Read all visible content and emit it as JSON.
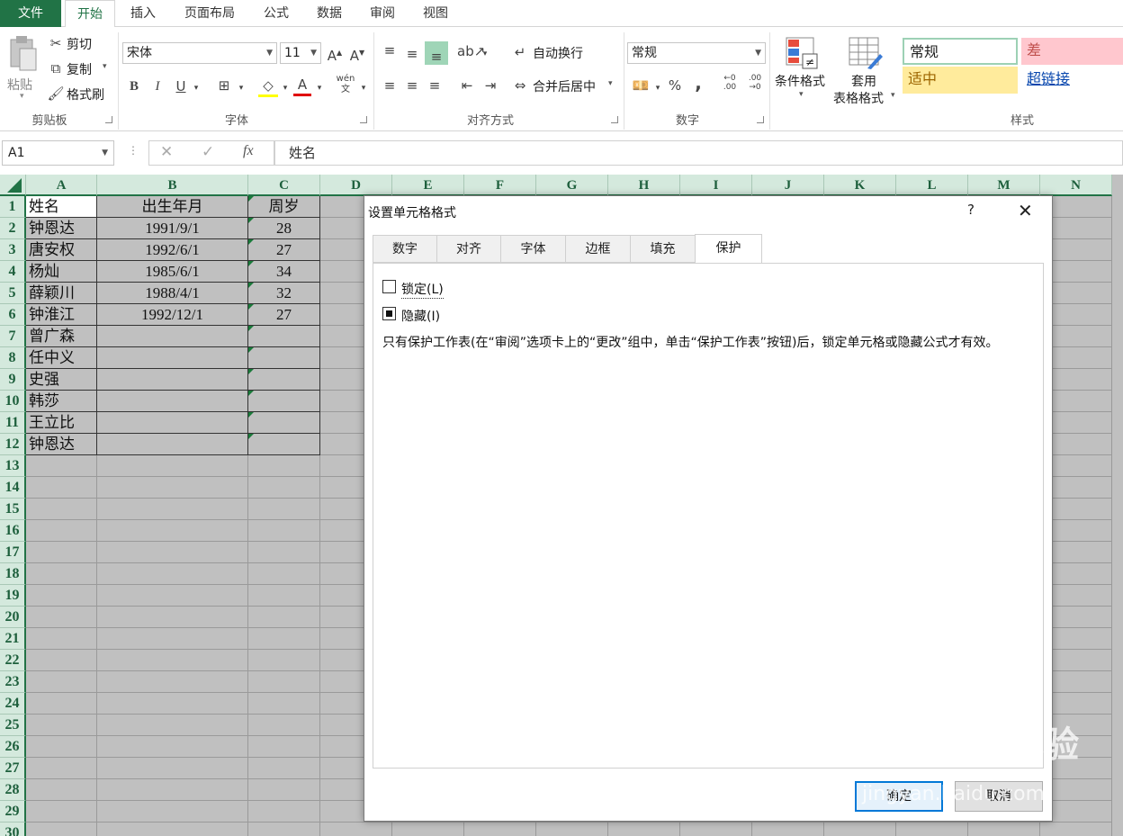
{
  "tabs": [
    "文件",
    "开始",
    "插入",
    "页面布局",
    "公式",
    "数据",
    "审阅",
    "视图"
  ],
  "ribbon": {
    "clipboard": {
      "paste": "粘贴",
      "cut": "剪切",
      "copy": "复制",
      "format_painter": "格式刷",
      "label": "剪贴板"
    },
    "font": {
      "name": "宋体",
      "size": "11",
      "label": "字体",
      "bold": "B",
      "italic": "I",
      "underline": "U",
      "color_a": "A",
      "phonetic": "wén 文"
    },
    "alignment": {
      "wrap": "自动换行",
      "merge": "合并后居中",
      "label": "对齐方式"
    },
    "number": {
      "format": "常规",
      "percent": "%",
      "comma": ",",
      "label": "数字"
    },
    "styles": {
      "conditional": "条件格式",
      "table_format_1": "套用",
      "table_format_2": "表格格式",
      "label": "样式",
      "cells": {
        "normal": "常规",
        "bad": "差",
        "neutral": "适中",
        "hyperlink": "超链接"
      }
    }
  },
  "formula_bar": {
    "name_box": "A1",
    "fx": "fx",
    "content": "姓名"
  },
  "columns": [
    "A",
    "B",
    "C",
    "D",
    "E",
    "F",
    "G",
    "H",
    "I",
    "J",
    "K",
    "L",
    "M",
    "N"
  ],
  "rows": [
    "1",
    "2",
    "3",
    "4",
    "5",
    "6",
    "7",
    "8",
    "9",
    "10",
    "11",
    "12",
    "13",
    "14",
    "15",
    "16",
    "17",
    "18",
    "19",
    "20",
    "21",
    "22",
    "23",
    "24",
    "25",
    "26",
    "27",
    "28",
    "29",
    "30"
  ],
  "table": {
    "headers": [
      "姓名",
      "出生年月",
      "周岁"
    ],
    "data": [
      [
        "钟恩达",
        "1991/9/1",
        "28"
      ],
      [
        "唐安权",
        "1992/6/1",
        "27"
      ],
      [
        "杨灿",
        "1985/6/1",
        "34"
      ],
      [
        "薛颖川",
        "1988/4/1",
        "32"
      ],
      [
        "钟淮江",
        "1992/12/1",
        "27"
      ],
      [
        "曾广森",
        "",
        ""
      ],
      [
        "任中义",
        "",
        ""
      ],
      [
        "史强",
        "",
        ""
      ],
      [
        "韩莎",
        "",
        ""
      ],
      [
        "王立比",
        "",
        ""
      ],
      [
        "钟恩达",
        "",
        ""
      ]
    ]
  },
  "dialog": {
    "title": "设置单元格格式",
    "help": "?",
    "close": "✕",
    "tabs": [
      "数字",
      "对齐",
      "字体",
      "边框",
      "填充",
      "保护"
    ],
    "active_tab": "保护",
    "locked_label": "锁定(L)",
    "locked_checked": false,
    "hidden_label": "隐藏(I)",
    "hidden_checked": true,
    "note": "只有保护工作表(在“审阅”选项卡上的“更改”组中，单击“保护工作表”按钮)后，锁定单元格或隐藏公式才有效。",
    "ok": "确定",
    "cancel": "取消"
  },
  "watermark": {
    "brand": "Bai du 经验",
    "site": "jingyan.baidu.com"
  },
  "colors": {
    "excel_green": "#217346",
    "header_bg": "#d4e9dd",
    "selection_gray": "#c0c0c0",
    "bad_bg": "#ffc7ce",
    "neutral_bg": "#ffeb9c"
  }
}
